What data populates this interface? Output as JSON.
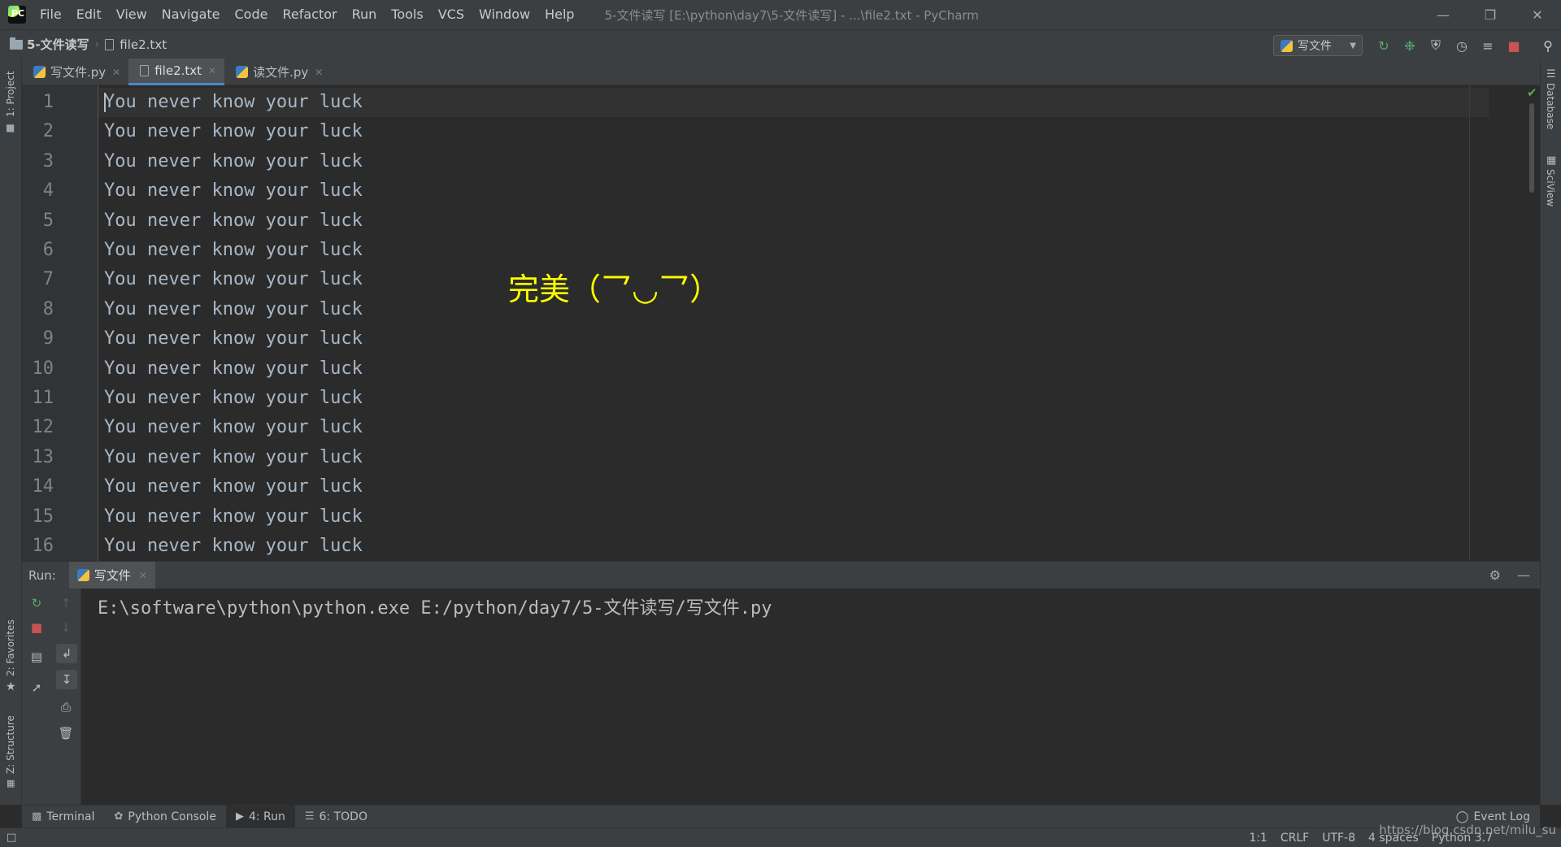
{
  "window": {
    "title": "5-文件读写 [E:\\python\\day7\\5-文件读写] - ...\\file2.txt - PyCharm",
    "logo_text": "PC"
  },
  "menu": [
    "File",
    "Edit",
    "View",
    "Navigate",
    "Code",
    "Refactor",
    "Run",
    "Tools",
    "VCS",
    "Window",
    "Help"
  ],
  "breadcrumb": {
    "project": "5-文件读写",
    "file": "file2.txt"
  },
  "run_config": {
    "label": "写文件"
  },
  "left_stripe": {
    "project": "1: Project",
    "favorites": "2: Favorites",
    "structure": "Z: Structure"
  },
  "right_stripe": {
    "database": "Database",
    "sciview": "SciView"
  },
  "tabs": [
    {
      "label": "写文件.py",
      "type": "python",
      "active": false
    },
    {
      "label": "file2.txt",
      "type": "text",
      "active": true
    },
    {
      "label": "读文件.py",
      "type": "python",
      "active": false
    }
  ],
  "editor": {
    "line_numbers": [
      "1",
      "2",
      "3",
      "4",
      "5",
      "6",
      "7",
      "8",
      "9",
      "10",
      "11",
      "12",
      "13",
      "14",
      "15",
      "16"
    ],
    "lines": [
      "You never know your luck",
      "You never know your luck",
      "You never know your luck",
      "You never know your luck",
      "You never know your luck",
      "You never know your luck",
      "You never know your luck",
      "You never know your luck",
      "You never know your luck",
      "You never know your luck",
      "You never know your luck",
      "You never know your luck",
      "You never know your luck",
      "You never know your luck",
      "You never know your luck",
      "You never know your luck"
    ],
    "annotation": "完美（乛◡乛）"
  },
  "run_panel": {
    "label": "Run:",
    "tab_label": "写文件",
    "console_output": "E:\\software\\python\\python.exe E:/python/day7/5-文件读写/写文件.py"
  },
  "bottom_tools": {
    "terminal": "Terminal",
    "python_console": "Python Console",
    "run": "4: Run",
    "todo": "6: TODO",
    "event_log": "Event Log"
  },
  "status": {
    "position": "1:1",
    "line_sep": "CRLF",
    "encoding": "UTF-8",
    "indent": "4 spaces",
    "interpreter": "Python 3.7"
  },
  "watermark": "https://blog.csdn.net/milu_su",
  "colors": {
    "annotation": "#ffff00",
    "active_tab_underline": "#4a88c7",
    "stop_red": "#c75450",
    "run_green": "#59a869"
  }
}
